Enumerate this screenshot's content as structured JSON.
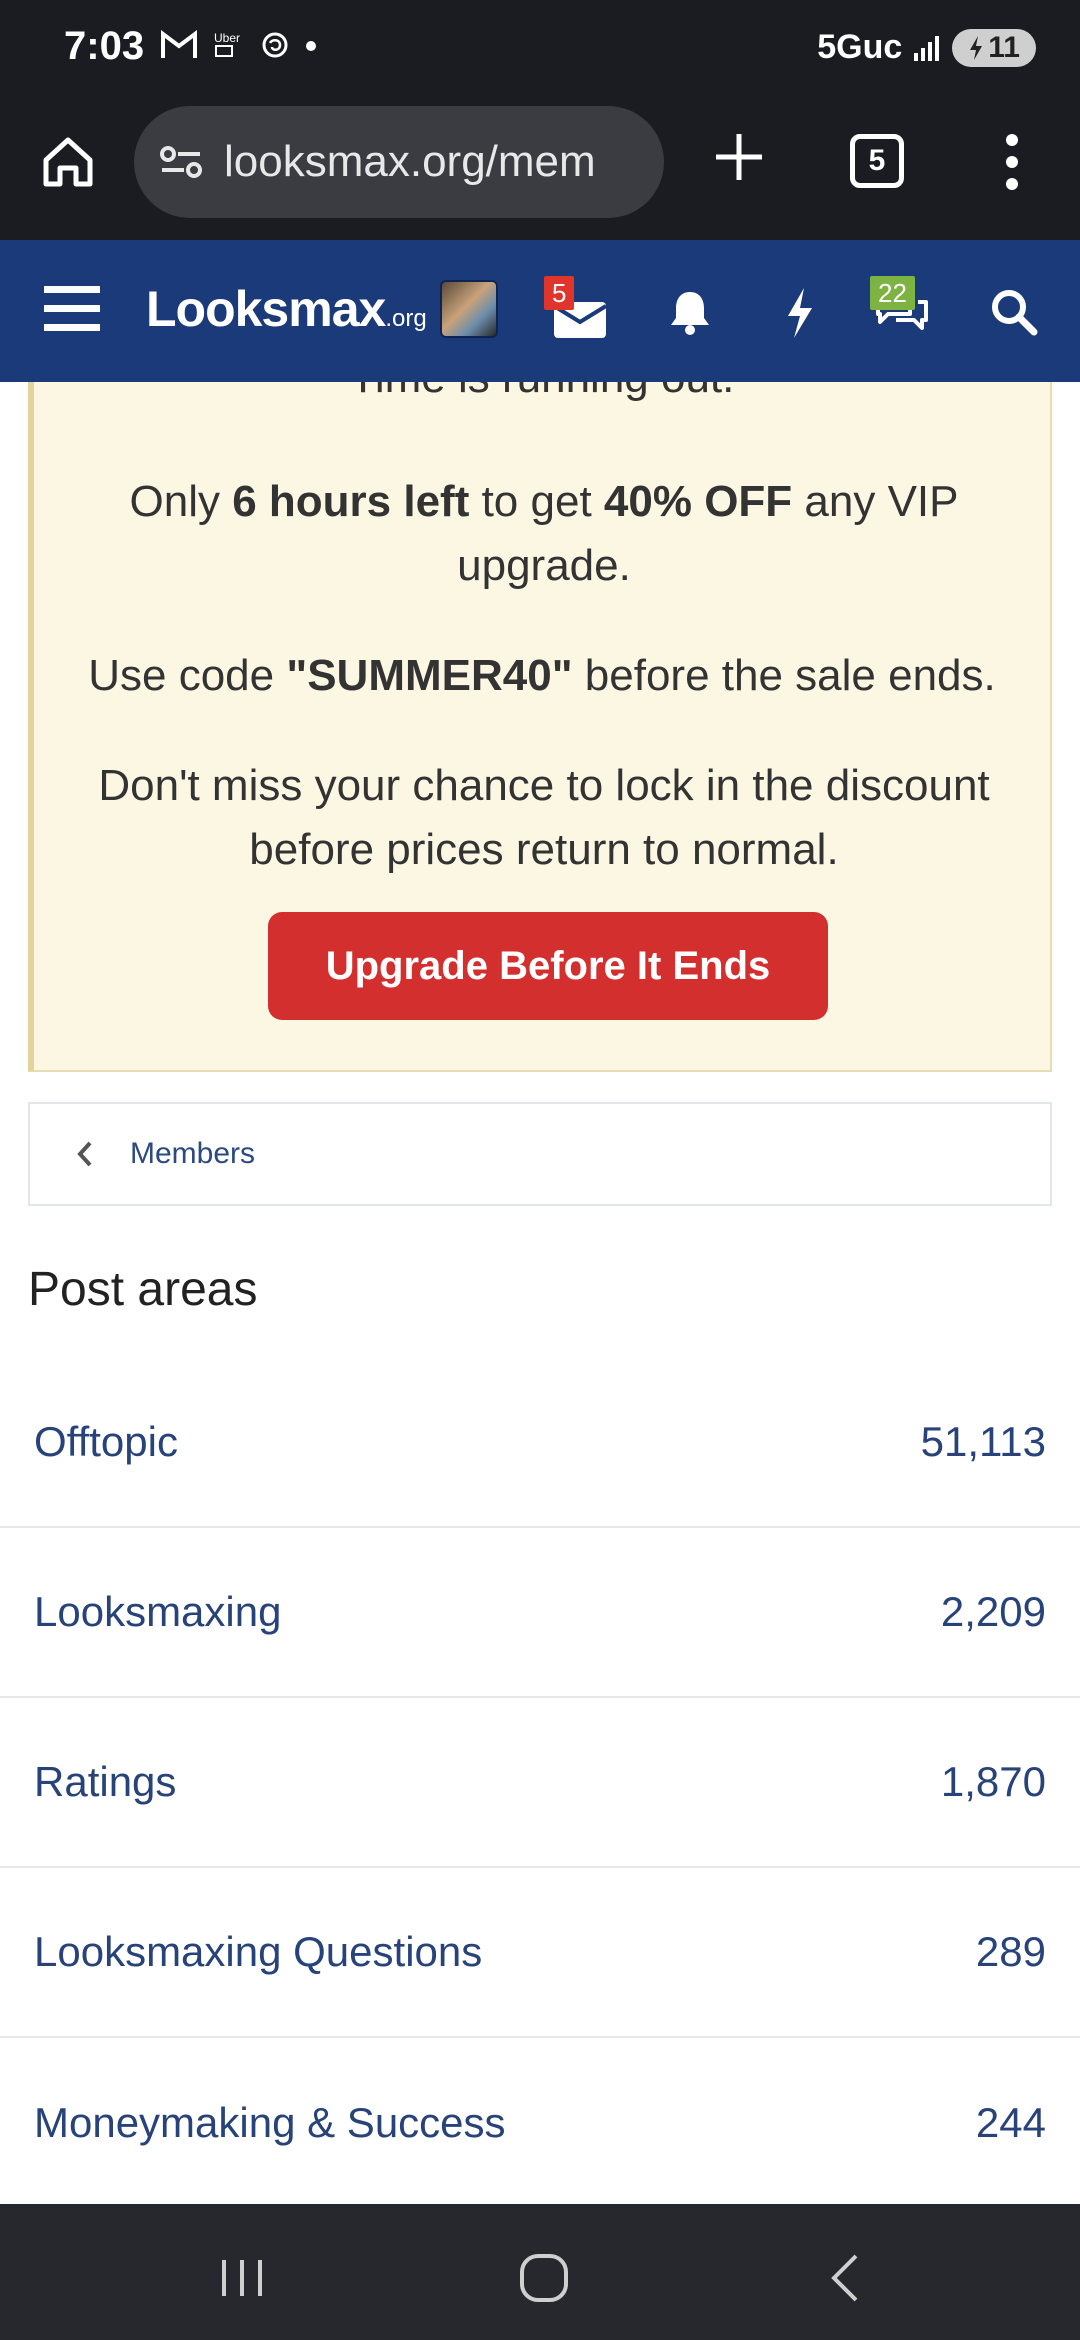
{
  "status_bar": {
    "time": "7:03",
    "network": "5Guc",
    "battery": "11",
    "left_icons": [
      "gmail-icon",
      "uber-icon",
      "threads-icon",
      "dot-icon"
    ]
  },
  "browser": {
    "url": "looksmax.org/mem",
    "tab_count": "5"
  },
  "site_header": {
    "logo_main": "Looksmax",
    "logo_suffix": ".org",
    "inbox_badge": "5",
    "conversations_badge": "22",
    "colors": {
      "header_bg": "#1b3a7a",
      "inbox_badge": "#e0352b",
      "conversations_badge": "#7cb342"
    }
  },
  "promo": {
    "line0": "Time is running out.",
    "line1_pre": "Only ",
    "line1_bold1": "6 hours left",
    "line1_mid": " to get ",
    "line1_bold2": "40% OFF",
    "line1_post": " any VIP upgrade.",
    "line2_pre": "Use code ",
    "line2_code": "\"SUMMER40\"",
    "line2_post": " before the sale ends.",
    "line3": "Don't miss your chance to lock in the discount before prices return to normal.",
    "button_label": "Upgrade Before It Ends",
    "colors": {
      "background": "#fcf7e3",
      "button": "#d32f2f"
    }
  },
  "breadcrumb": {
    "label": "Members"
  },
  "post_areas": {
    "title": "Post areas",
    "rows": [
      {
        "label": "Offtopic",
        "count": "51,113"
      },
      {
        "label": "Looksmaxing",
        "count": "2,209"
      },
      {
        "label": "Ratings",
        "count": "1,870"
      },
      {
        "label": "Looksmaxing Questions",
        "count": "289"
      },
      {
        "label": "Moneymaking & Success",
        "count": "244"
      }
    ]
  }
}
